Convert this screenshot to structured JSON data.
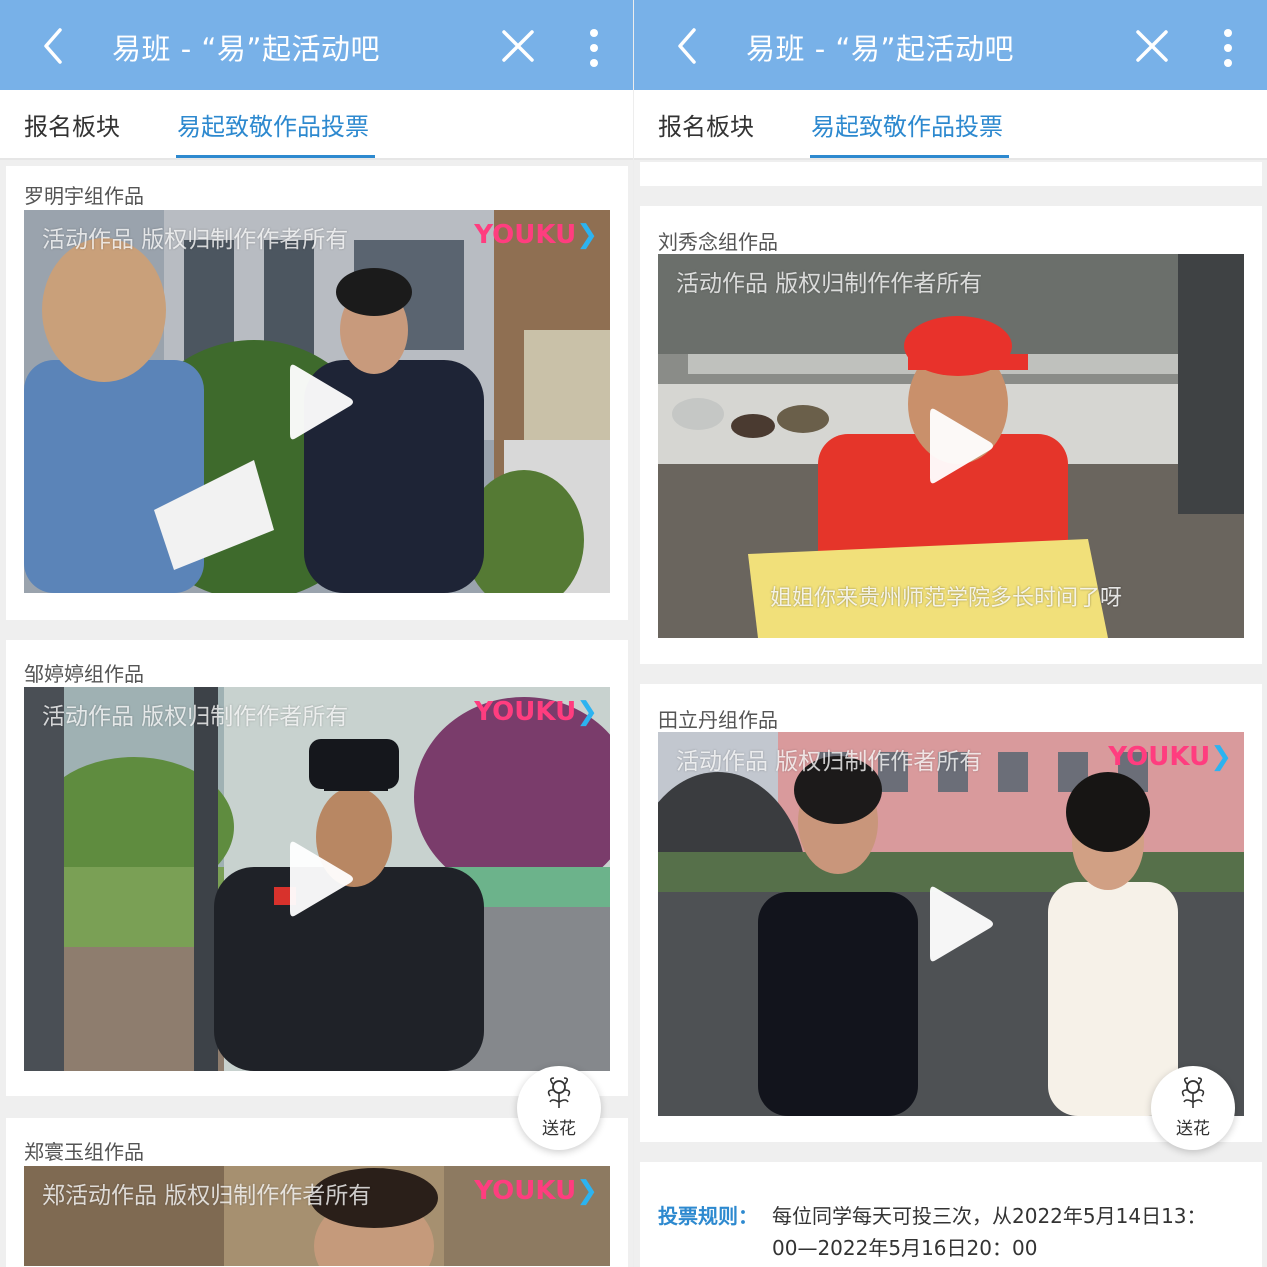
{
  "screens": [
    {
      "header": {
        "title": "易班 - “易”起活动吧"
      },
      "tabs": [
        "报名板块",
        "易起致敬作品投票"
      ],
      "entries": [
        {
          "title": "罗明宇组作品",
          "watermark": "活动作品 版权归制作作者所有",
          "brand": "YOUKU"
        },
        {
          "title": "邹婷婷组作品",
          "watermark": "活动作品 版权归制作作者所有",
          "brand": "YOUKU"
        },
        {
          "title": "郑寰玉组作品",
          "watermark": "郑活动作品 版权归制作作者所有",
          "brand": "YOUKU"
        }
      ],
      "flower_button": {
        "label": "送花",
        "icon": "flower-icon"
      }
    },
    {
      "header": {
        "title": "易班 - “易”起活动吧"
      },
      "tabs": [
        "报名板块",
        "易起致敬作品投票"
      ],
      "entries": [
        {
          "title": "刘秀念组作品",
          "watermark": "活动作品 版权归制作作者所有",
          "subtitle": "姐姐你来贵州师范学院多长时间了呀"
        },
        {
          "title": "田立丹组作品",
          "watermark": "活动作品 版权归制作作者所有",
          "brand": "YOUKU"
        }
      ],
      "flower_button": {
        "label": "送花",
        "icon": "flower-icon"
      },
      "vote_rules": {
        "label": "投票规则：",
        "text": "每位同学每天可投三次，从2022年5月14日13：00—2022年5月16日20：00"
      }
    }
  ],
  "colors": {
    "header_bg": "#78b1e8",
    "tab_active": "#2d89cf",
    "page_bg": "#efefef",
    "youku_pink": "#ff3d7f",
    "youku_blue": "#2cb3f0"
  }
}
